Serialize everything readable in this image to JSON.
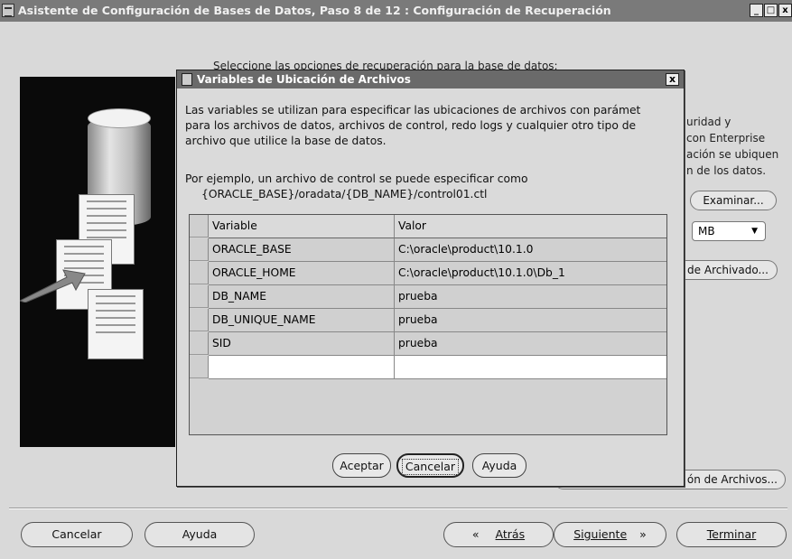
{
  "window": {
    "title": "Asistente de Configuración de Bases de Datos, Paso 8 de 12 : Configuración de Recuperación",
    "minimize": "_",
    "maximize": "□",
    "close": "x"
  },
  "background": {
    "intro_text": "Seleccione las opciones de recuperación para la base de datos:",
    "side_lines": [
      "uridad y",
      "con Enterprise",
      "ación se ubiquen",
      "n de los datos."
    ],
    "browse_button": "Examinar...",
    "size_unit": "MB",
    "archive_button": "de Archivado...",
    "file_locations_button": "ón de Archivos...",
    "nav": {
      "cancel": "Cancelar",
      "help": "Ayuda",
      "back_arrow": "«",
      "back": "Atrás",
      "next": "Siguiente",
      "next_arrow": "»",
      "finish": "Terminar"
    }
  },
  "dialog": {
    "title": "Variables de Ubicación de Archivos",
    "close": "x",
    "description": [
      "Las variables se utilizan para especificar las ubicaciones de archivos con parámet",
      "para los archivos de datos, archivos de control, redo logs y cualquier otro tipo de",
      "archivo que utilice la base de datos."
    ],
    "example": [
      "Por ejemplo, un archivo de control se puede especificar como",
      "{ORACLE_BASE}/oradata/{DB_NAME}/control01.ctl"
    ],
    "table": {
      "headers": [
        "Variable",
        "Valor"
      ],
      "rows": [
        {
          "variable": "ORACLE_BASE",
          "valor": "C:\\oracle\\product\\10.1.0"
        },
        {
          "variable": "ORACLE_HOME",
          "valor": "C:\\oracle\\product\\10.1.0\\Db_1"
        },
        {
          "variable": "DB_NAME",
          "valor": "prueba"
        },
        {
          "variable": "DB_UNIQUE_NAME",
          "valor": "prueba"
        },
        {
          "variable": "SID",
          "valor": "prueba"
        }
      ]
    },
    "buttons": {
      "ok": "Aceptar",
      "cancel": "Cancelar",
      "help": "Ayuda"
    }
  }
}
